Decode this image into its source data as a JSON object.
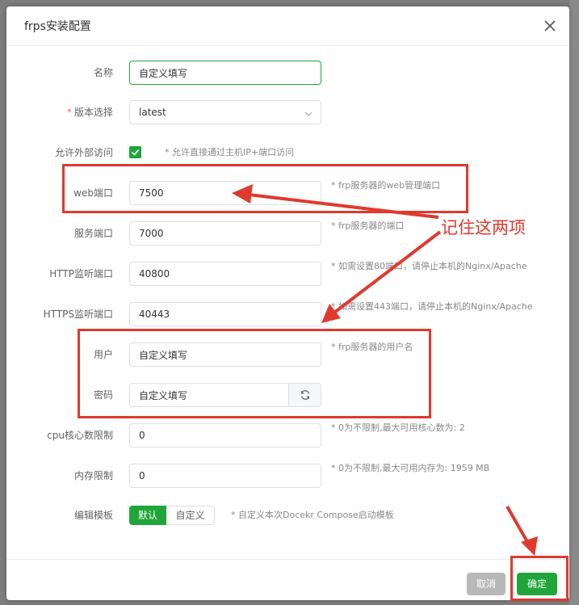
{
  "dialog": {
    "title": "frps安装配置",
    "close_icon": "close-icon"
  },
  "fields": {
    "name": {
      "label": "名称",
      "value": "自定义填写"
    },
    "version": {
      "required_mark": "*",
      "label": "版本选择",
      "value": "latest"
    },
    "external": {
      "label": "允许外部访问",
      "checked": true,
      "hint": "* 允许直接通过主机IP+端口访问"
    },
    "web_port": {
      "label": "web端口",
      "value": "7500",
      "hint": "* frp服务器的web管理端口"
    },
    "service_port": {
      "label": "服务端口",
      "value": "7000",
      "hint": "* frp服务器的端口"
    },
    "http_port": {
      "label": "HTTP监听端口",
      "value": "40800",
      "hint": "* 如需设置80端口，请停止本机的Nginx/Apache"
    },
    "https_port": {
      "label": "HTTPS监听端口",
      "value": "40443",
      "hint": "* 如需设置443端口，请停止本机的Nginx/Apache"
    },
    "user": {
      "label": "用户",
      "value": "自定义填写",
      "hint": "* frp服务器的用户名"
    },
    "password": {
      "label": "密码",
      "value": "自定义填写"
    },
    "cpu": {
      "label": "cpu核心数限制",
      "value": "0",
      "hint": "* 0为不限制,最大可用核心数为: 2"
    },
    "memory": {
      "label": "内存限制",
      "value": "0",
      "hint": "* 0为不限制,最大可用内存为: 1959 MB"
    },
    "template": {
      "label": "编辑模板",
      "option_default": "默认",
      "option_custom": "自定义",
      "hint": "* 自定义本次Docekr Compose启动模板"
    }
  },
  "footer": {
    "cancel_label": "取消",
    "confirm_label": "确定"
  },
  "annotation": {
    "text": "记住这两项",
    "color": "#e0392e"
  },
  "colors": {
    "accent": "#20a53a",
    "annotation": "#e0392e"
  }
}
